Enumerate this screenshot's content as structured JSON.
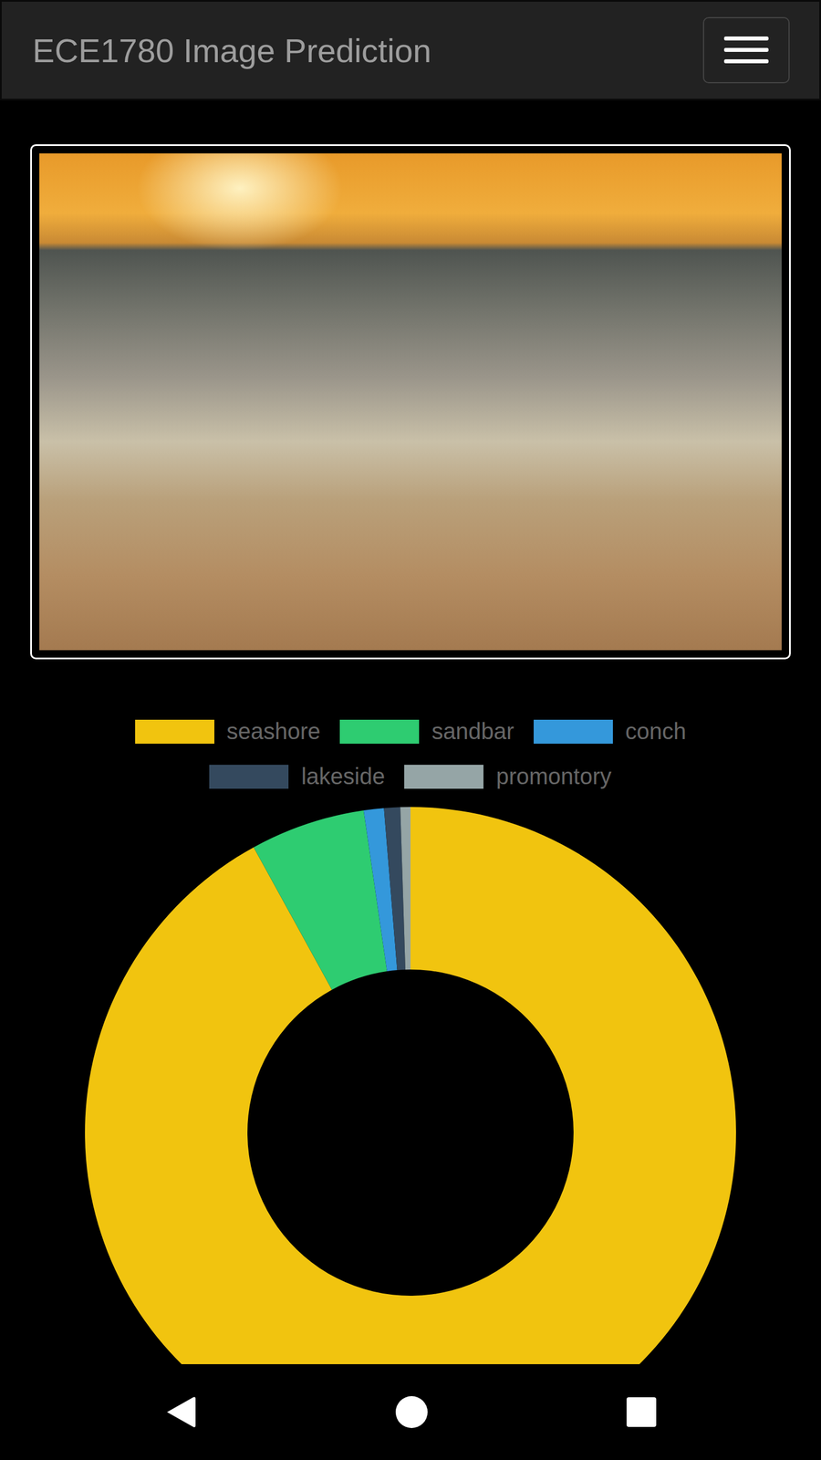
{
  "navbar": {
    "title": "ECE1780 Image Prediction"
  },
  "chart": {
    "values": [
      0.92,
      0.057,
      0.01,
      0.008,
      0.005
    ],
    "legend": [
      {
        "label": "seashore",
        "color": "#f1c40f"
      },
      {
        "label": "sandbar",
        "color": "#2ecc71"
      },
      {
        "label": "conch",
        "color": "#3498db"
      },
      {
        "label": "lakeside",
        "color": "#34495e"
      },
      {
        "label": "promontory",
        "color": "#95a5a6"
      }
    ]
  }
}
